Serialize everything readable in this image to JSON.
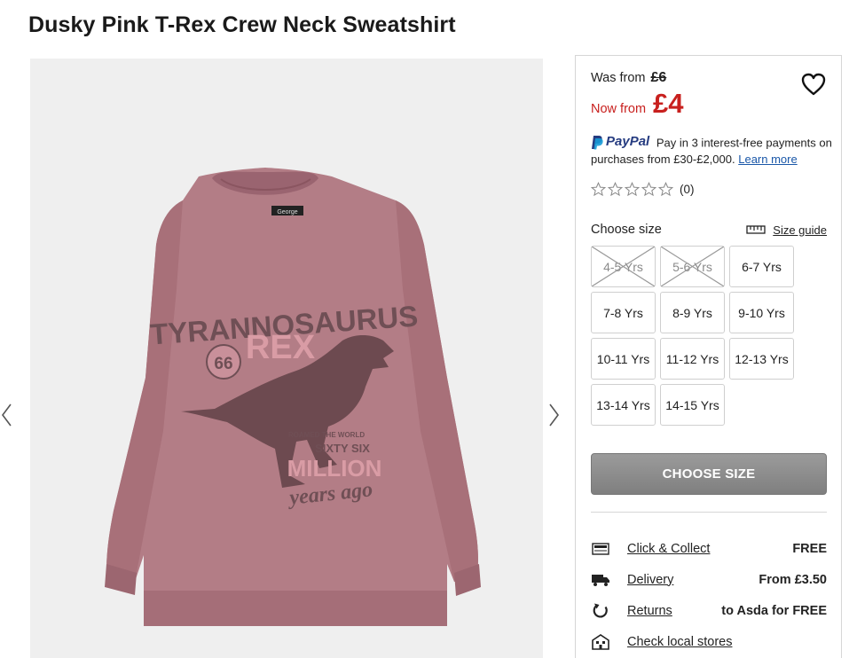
{
  "product": {
    "title": "Dusky Pink T-Rex Crew Neck Sweatshirt"
  },
  "gallery": {
    "prev_icon": "chevron-left-icon",
    "next_icon": "chevron-right-icon",
    "print": {
      "line1": "TYRANNOSAURUS",
      "line2": "REX",
      "badge": "66",
      "small1": "ROAMED THE WORLD",
      "small2": "SIXTY SIX",
      "big": "MILLION",
      "script": "years ago"
    },
    "neck_label": "George"
  },
  "price": {
    "was_label": "Was from",
    "was_value": "£6",
    "now_label": "Now from",
    "now_value": "£4",
    "now_color": "#c8201e"
  },
  "wishlist_icon": "heart-icon",
  "paypal": {
    "brand": "PayPal",
    "message": "Pay in 3 interest-free payments on purchases from £30-£2,000.",
    "link": "Learn more"
  },
  "rating": {
    "stars": 0,
    "count": "(0)"
  },
  "size": {
    "label": "Choose size",
    "guide": "Size guide",
    "options": [
      {
        "label": "4-5 Yrs",
        "available": false
      },
      {
        "label": "5-6 Yrs",
        "available": false
      },
      {
        "label": "6-7 Yrs",
        "available": true
      },
      {
        "label": "7-8 Yrs",
        "available": true
      },
      {
        "label": "8-9 Yrs",
        "available": true
      },
      {
        "label": "9-10 Yrs",
        "available": true
      },
      {
        "label": "10-11 Yrs",
        "available": true
      },
      {
        "label": "11-12 Yrs",
        "available": true
      },
      {
        "label": "12-13 Yrs",
        "available": true
      },
      {
        "label": "13-14 Yrs",
        "available": true
      },
      {
        "label": "14-15 Yrs",
        "available": true
      }
    ]
  },
  "cta": {
    "label": "CHOOSE SIZE"
  },
  "delivery": [
    {
      "icon": "store-icon",
      "label": "Click & Collect",
      "value": "FREE"
    },
    {
      "icon": "truck-icon",
      "label": "Delivery",
      "value": "From £3.50"
    },
    {
      "icon": "returns-icon",
      "label": "Returns",
      "value": "to Asda for FREE"
    },
    {
      "icon": "shop-building-icon",
      "label": "Check local stores",
      "value": ""
    }
  ]
}
